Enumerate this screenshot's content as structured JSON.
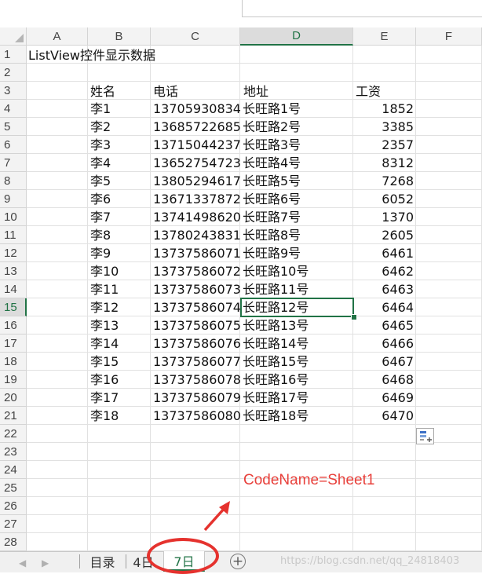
{
  "columns": [
    "A",
    "B",
    "C",
    "D",
    "E",
    "F"
  ],
  "selected_column": "D",
  "selected_row": "15",
  "rows": [
    "1",
    "2",
    "3",
    "4",
    "5",
    "6",
    "7",
    "8",
    "9",
    "10",
    "11",
    "12",
    "13",
    "14",
    "15",
    "16",
    "17",
    "18",
    "19",
    "20",
    "21",
    "22",
    "23",
    "24",
    "25",
    "26",
    "27",
    "28"
  ],
  "title_cell": "ListView控件显示数据",
  "table_headers": {
    "name": "姓名",
    "phone": "电话",
    "address": "地址",
    "salary": "工资"
  },
  "table_rows": [
    {
      "name": "李1",
      "phone": "13705930834",
      "address": "长旺路1号",
      "salary": "1852"
    },
    {
      "name": "李2",
      "phone": "13685722685",
      "address": "长旺路2号",
      "salary": "3385"
    },
    {
      "name": "李3",
      "phone": "13715044237",
      "address": "长旺路3号",
      "salary": "2357"
    },
    {
      "name": "李4",
      "phone": "13652754723",
      "address": "长旺路4号",
      "salary": "8312"
    },
    {
      "name": "李5",
      "phone": "13805294617",
      "address": "长旺路5号",
      "salary": "7268"
    },
    {
      "name": "李6",
      "phone": "13671337872",
      "address": "长旺路6号",
      "salary": "6052"
    },
    {
      "name": "李7",
      "phone": "13741498620",
      "address": "长旺路7号",
      "salary": "1370"
    },
    {
      "name": "李8",
      "phone": "13780243831",
      "address": "长旺路8号",
      "salary": "2605"
    },
    {
      "name": "李9",
      "phone": "13737586071",
      "address": "长旺路9号",
      "salary": "6461"
    },
    {
      "name": "李10",
      "phone": "13737586072",
      "address": "长旺路10号",
      "salary": "6462"
    },
    {
      "name": "李11",
      "phone": "13737586073",
      "address": "长旺路11号",
      "salary": "6463"
    },
    {
      "name": "李12",
      "phone": "13737586074",
      "address": "长旺路12号",
      "salary": "6464"
    },
    {
      "name": "李13",
      "phone": "13737586075",
      "address": "长旺路13号",
      "salary": "6465"
    },
    {
      "name": "李14",
      "phone": "13737586076",
      "address": "长旺路14号",
      "salary": "6466"
    },
    {
      "name": "李15",
      "phone": "13737586077",
      "address": "长旺路15号",
      "salary": "6467"
    },
    {
      "name": "李16",
      "phone": "13737586078",
      "address": "长旺路16号",
      "salary": "6468"
    },
    {
      "name": "李17",
      "phone": "13737586079",
      "address": "长旺路17号",
      "salary": "6469"
    },
    {
      "name": "李18",
      "phone": "13737586080",
      "address": "长旺路18号",
      "salary": "6470"
    }
  ],
  "sheet_tabs": [
    {
      "label": "目录",
      "active": false
    },
    {
      "label": "4日",
      "active": false
    },
    {
      "label": "7日",
      "active": true
    }
  ],
  "annotation": "CodeName=Sheet1",
  "watermark": "https://blog.csdn.net/qq_24818403",
  "colors": {
    "accent": "#217346",
    "annotation": "#e8403b",
    "circle": "#e5322e"
  },
  "icons": {
    "add_sheet": "plus-circle-icon",
    "quick_analysis": "quick-analysis-icon",
    "prev": "chevron-left-icon",
    "next": "chevron-right-icon"
  }
}
